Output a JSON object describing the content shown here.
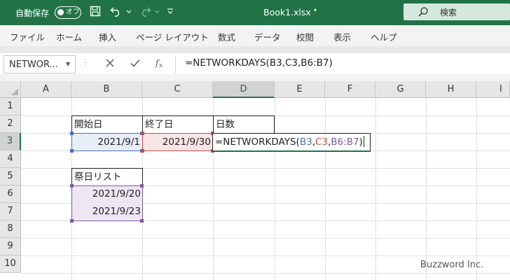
{
  "titlebar": {
    "autosave_label": "自動保存",
    "autosave_state": "オフ",
    "title": "Book1.xlsx",
    "title_caret": "▾",
    "search_label": "検索",
    "bg_color": "#217346"
  },
  "ribbon": {
    "tabs": [
      "ファイル",
      "ホーム",
      "挿入",
      "ページ レイアウト",
      "数式",
      "データ",
      "校閲",
      "表示",
      "ヘルプ"
    ]
  },
  "formula_bar": {
    "name_box": "NETWOR...",
    "formula": "=NETWORKDAYS(B3,C3,B6:B7)"
  },
  "sheet": {
    "columns": [
      "A",
      "B",
      "C",
      "D",
      "E",
      "F",
      "G",
      "H",
      "I"
    ],
    "rows": [
      "1",
      "2",
      "3",
      "4",
      "5",
      "6",
      "7",
      "8",
      "9",
      "10"
    ],
    "active_column": "D",
    "active_row": "3",
    "cells": {
      "B2": "開始日",
      "C2": "終了日",
      "D2": "日数",
      "B3": "2021/9/1",
      "C3": "2021/9/30",
      "B5": "祭日リスト",
      "B6": "2021/9/20",
      "B7": "2021/9/23"
    },
    "edit_cell": {
      "prefix": "=NETWORKDAYS(",
      "ref1": "B3",
      "comma1": ",",
      "ref2": "C3",
      "comma2": ",",
      "ref3": "B6:B7",
      "suffix": ")"
    },
    "ref_colors": {
      "ref1": "#4472c4",
      "ref2": "#c0504d",
      "ref3": "#7f5aa2"
    }
  },
  "watermark": "Buzzword Inc."
}
